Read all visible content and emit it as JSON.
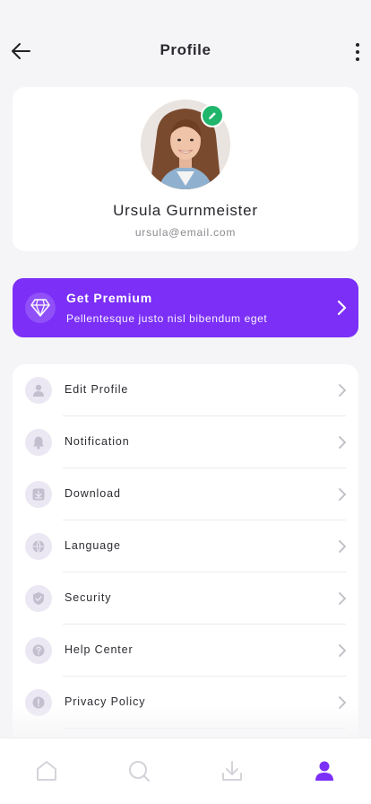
{
  "header": {
    "title": "Profile"
  },
  "profile": {
    "name": "Ursula Gurnmeister",
    "email": "ursula@email.com"
  },
  "premium": {
    "title": "Get Premium",
    "subtitle": "Pellentesque justo nisl bibendum eget"
  },
  "menu": {
    "items": [
      {
        "label": "Edit Profile",
        "icon": "user-icon"
      },
      {
        "label": "Notification",
        "icon": "bell-icon"
      },
      {
        "label": "Download",
        "icon": "download-icon"
      },
      {
        "label": "Language",
        "icon": "globe-icon"
      },
      {
        "label": "Security",
        "icon": "shield-icon"
      },
      {
        "label": "Help Center",
        "icon": "help-icon"
      },
      {
        "label": "Privacy Policy",
        "icon": "alert-icon"
      }
    ]
  },
  "bottom_nav": {
    "items": [
      "home-icon",
      "search-icon",
      "download-icon",
      "profile-icon"
    ],
    "active": "profile-icon"
  },
  "colors": {
    "accent": "#7b2ff7",
    "edit_badge": "#1fb66b",
    "icon_bg": "#ebe8f3",
    "icon_fg": "#c3bfcf"
  }
}
